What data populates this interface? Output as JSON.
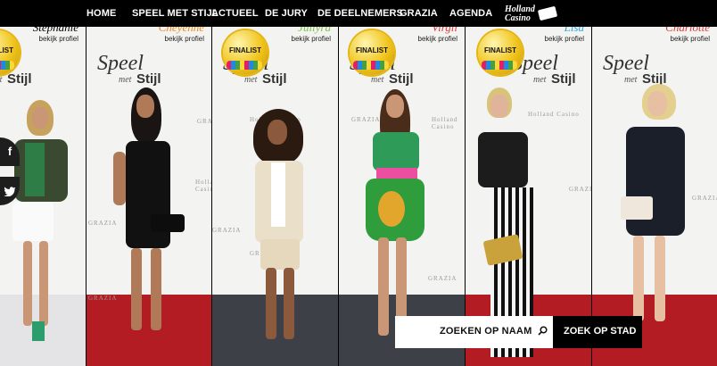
{
  "nav": {
    "items": [
      "HOME",
      "SPEEL MET STIJL",
      "ACTUEEL",
      "DE JURY",
      "DE DEELNEMERS",
      "GRAZIA",
      "AGENDA"
    ],
    "logo": [
      "Holland",
      "Casino"
    ]
  },
  "brand": {
    "speel": "Speel",
    "met": "met",
    "stijl": "Stijl"
  },
  "watermark": {
    "grazia": "GRAZIA",
    "holland": "Holland Casino"
  },
  "contestants": [
    {
      "name": "Stephanie",
      "profile": "bekijk profiel",
      "name_color": "#e8c300",
      "finalist": true
    },
    {
      "name": "Cheyenne",
      "profile": "bekijk profiel",
      "name_color": "#f08a24",
      "finalist": false
    },
    {
      "name": "Juliyra",
      "profile": "bekijk profiel",
      "name_color": "#7cc242",
      "finalist": true
    },
    {
      "name": "Virgil",
      "profile": "bekijk profiel",
      "name_color": "#e23a3a",
      "finalist": true
    },
    {
      "name": "Lisa",
      "profile": "bekijk profiel",
      "name_color": "#2aa7df",
      "finalist": true
    },
    {
      "name": "Charlotte",
      "profile": "bekijk profiel",
      "name_color": "#e23a3a",
      "finalist": false
    }
  ],
  "finalist_label": "FINALIST",
  "social": {
    "facebook": "f",
    "twitter": "t"
  },
  "search": {
    "name_label": "ZOEKEN OP NAAM",
    "city_label": "ZOEK OP STAD"
  }
}
